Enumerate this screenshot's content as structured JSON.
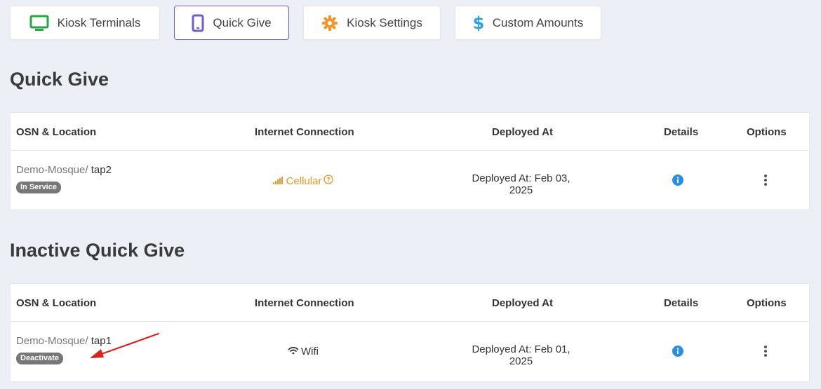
{
  "tabs": [
    {
      "label": "Kiosk Terminals",
      "icon": "monitor-icon",
      "color": "#27a844",
      "active": false
    },
    {
      "label": "Quick Give",
      "icon": "tablet-icon",
      "color": "#6f5fc4",
      "active": true
    },
    {
      "label": "Kiosk Settings",
      "icon": "gear-icon",
      "color": "#f5962a",
      "active": false
    },
    {
      "label": "Custom Amounts",
      "icon": "dollar-icon",
      "color": "#2b9fe0",
      "active": false
    }
  ],
  "active_section": {
    "title": "Quick Give",
    "columns": [
      "OSN & Location",
      "Internet Connection",
      "Deployed At",
      "Details",
      "Options"
    ],
    "rows": [
      {
        "org": "Demo-Mosque/",
        "location": "tap2",
        "badge": "In Service",
        "connection": "Cellular",
        "deployed": "Deployed At: Feb 03, 2025"
      }
    ]
  },
  "inactive_section": {
    "title": "Inactive Quick Give",
    "columns": [
      "OSN & Location",
      "Internet Connection",
      "Deployed At",
      "Details",
      "Options"
    ],
    "rows": [
      {
        "org": "Demo-Mosque/",
        "location": "tap1",
        "badge": "Deactivate",
        "connection": "Wifi",
        "deployed": "Deployed At: Feb 01, 2025"
      }
    ]
  },
  "colors": {
    "cellular": "#e8962a",
    "info": "#2b8fe0",
    "annotation_arrow": "#d9211f"
  }
}
